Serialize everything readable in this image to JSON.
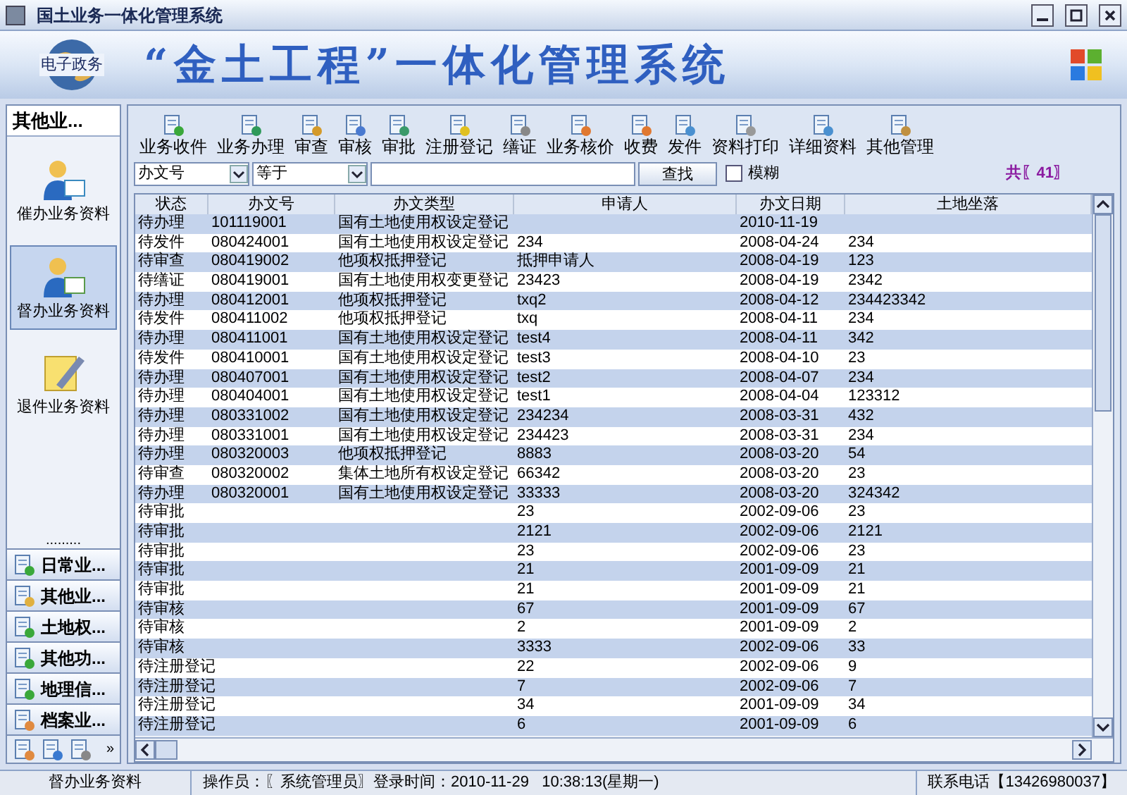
{
  "window": {
    "title": "国土业务一体化管理系统"
  },
  "banner": {
    "logo_text": "电子政务",
    "title": "“金土工程”一体化管理系统"
  },
  "sidebar": {
    "header": "其他业...",
    "items": [
      {
        "label": "催办业务资料",
        "selected": false
      },
      {
        "label": "督办业务资料",
        "selected": true
      },
      {
        "label": "退件业务资料",
        "selected": false
      }
    ],
    "separator": ".........",
    "categories": [
      "日常业...",
      "其他业...",
      "土地权...",
      "其他功...",
      "地理信...",
      "档案业..."
    ],
    "more": "»"
  },
  "toolbar": [
    "业务收件",
    "业务办理",
    "审查",
    "审核",
    "审批",
    "注册登记",
    "缮证",
    "业务核价",
    "收费",
    "发件",
    "资料打印",
    "详细资料",
    "其他管理"
  ],
  "search": {
    "field": "办文号",
    "operator": "等于",
    "button": "查找",
    "fuzzy_label": "模糊",
    "fuzzy_checked": false,
    "count": "共〖41〗"
  },
  "table": {
    "columns": [
      "状态",
      "办文号",
      "办文类型",
      "申请人",
      "办文日期",
      "土地坐落"
    ],
    "rows": [
      [
        "待办理",
        "101119001",
        "国有土地使用权设定登记",
        "",
        "2010-11-19",
        ""
      ],
      [
        "待发件",
        "080424001",
        "国有土地使用权设定登记",
        "234",
        "2008-04-24",
        "234"
      ],
      [
        "待审查",
        "080419002",
        "他项权抵押登记",
        "抵押申请人",
        "2008-04-19",
        "123"
      ],
      [
        "待缮证",
        "080419001",
        "国有土地使用权变更登记",
        "23423",
        "2008-04-19",
        "2342"
      ],
      [
        "待办理",
        "080412001",
        "他项权抵押登记",
        "txq2",
        "2008-04-12",
        "234423342"
      ],
      [
        "待发件",
        "080411002",
        "他项权抵押登记",
        "txq",
        "2008-04-11",
        "234"
      ],
      [
        "待办理",
        "080411001",
        "国有土地使用权设定登记",
        "test4",
        "2008-04-11",
        "342"
      ],
      [
        "待发件",
        "080410001",
        "国有土地使用权设定登记",
        "test3",
        "2008-04-10",
        "23"
      ],
      [
        "待办理",
        "080407001",
        "国有土地使用权设定登记",
        "test2",
        "2008-04-07",
        "234"
      ],
      [
        "待办理",
        "080404001",
        "国有土地使用权设定登记",
        "test1",
        "2008-04-04",
        "123312"
      ],
      [
        "待办理",
        "080331002",
        "国有土地使用权设定登记",
        "234234",
        "2008-03-31",
        "432"
      ],
      [
        "待办理",
        "080331001",
        "国有土地使用权设定登记",
        "234423",
        "2008-03-31",
        "234"
      ],
      [
        "待办理",
        "080320003",
        "他项权抵押登记",
        "8883",
        "2008-03-20",
        "54"
      ],
      [
        "待审查",
        "080320002",
        "集体土地所有权设定登记",
        "66342",
        "2008-03-20",
        "23"
      ],
      [
        "待办理",
        "080320001",
        "国有土地使用权设定登记",
        "33333",
        "2008-03-20",
        "324342"
      ],
      [
        "待审批",
        "",
        "",
        "23",
        "2002-09-06",
        "23"
      ],
      [
        "待审批",
        "",
        "",
        "2121",
        "2002-09-06",
        "2121"
      ],
      [
        "待审批",
        "",
        "",
        "23",
        "2002-09-06",
        "23"
      ],
      [
        "待审批",
        "",
        "",
        "21",
        "2001-09-09",
        "21"
      ],
      [
        "待审批",
        "",
        "",
        "21",
        "2001-09-09",
        "21"
      ],
      [
        "待审核",
        "",
        "",
        "67",
        "2001-09-09",
        "67"
      ],
      [
        "待审核",
        "",
        "",
        "2",
        "2001-09-09",
        "2"
      ],
      [
        "待审核",
        "",
        "",
        "3333",
        "2002-09-06",
        "33"
      ],
      [
        "待注册登记",
        "",
        "",
        "22",
        "2002-09-06",
        "9"
      ],
      [
        "待注册登记",
        "",
        "",
        "7",
        "2002-09-06",
        "7"
      ],
      [
        "待注册登记",
        "",
        "",
        "34",
        "2001-09-09",
        "34"
      ],
      [
        "待注册登记",
        "",
        "",
        "6",
        "2001-09-09",
        "6"
      ]
    ]
  },
  "status_bar": {
    "section": "督办业务资料",
    "login": "操作员：〖系统管理员〗登录时间：2010-11-29   10:38:13(星期一)",
    "phone": "联系电话【13426980037】"
  }
}
